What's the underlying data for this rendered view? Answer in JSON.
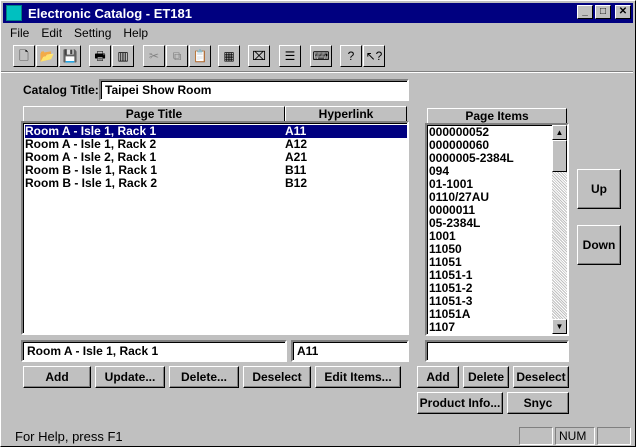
{
  "window": {
    "title": "Electronic Catalog - ET181",
    "minimize_glyph": "_",
    "maximize_glyph": "□",
    "close_glyph": "✕"
  },
  "menu": [
    {
      "label": "File"
    },
    {
      "label": "Edit"
    },
    {
      "label": "Setting"
    },
    {
      "label": "Help"
    }
  ],
  "toolbar": {
    "icons": [
      "new-file-icon",
      "open-folder-icon",
      "save-icon",
      "print-icon",
      "barcode-icon",
      "cut-icon",
      "copy-icon",
      "paste-icon",
      "calculator-icon",
      "scanner-icon",
      "document-icon",
      "keyboard-icon",
      "help-icon",
      "context-help-icon"
    ],
    "glyphs": [
      "🗋",
      "📂",
      "💾",
      "🖶",
      "▥",
      "✂",
      "⧉",
      "📋",
      "▦",
      "⌧",
      "☰",
      "⌨",
      "?",
      "↖?"
    ]
  },
  "catalog": {
    "title_label": "Catalog Title:",
    "title_value": "Taipei Show Room"
  },
  "pages": {
    "columns": [
      "Page Title",
      "Hyperlink"
    ],
    "rows": [
      {
        "title": "Room A - Isle 1, Rack 1",
        "link": "A11",
        "selected": true
      },
      {
        "title": "Room A - Isle 1, Rack 2",
        "link": "A12",
        "selected": false
      },
      {
        "title": "Room A - Isle 2, Rack 1",
        "link": "A21",
        "selected": false
      },
      {
        "title": "Room B - Isle 1, Rack 1",
        "link": "B11",
        "selected": false
      },
      {
        "title": "Room B - Isle 1, Rack 2",
        "link": "B12",
        "selected": false
      }
    ],
    "edit_title": "Room A - Isle 1, Rack 1",
    "edit_link": "A11",
    "buttons": {
      "add": "Add",
      "update": "Update...",
      "delete": "Delete...",
      "deselect": "Deselect",
      "edit_items": "Edit Items..."
    }
  },
  "items": {
    "header": "Page Items",
    "list": [
      "000000052",
      "000000060",
      "0000005-2384L",
      "094",
      "01-1001",
      "0110/27AU",
      "0000011",
      "05-2384L",
      "1001",
      "11050",
      "11051",
      "11051-1",
      "11051-2",
      "11051-3",
      "11051A",
      "1107"
    ],
    "edit_value": "",
    "buttons": {
      "add": "Add",
      "delete": "Delete",
      "deselect": "Deselect",
      "product_info": "Product Info...",
      "sync": "Snyc"
    }
  },
  "side_buttons": {
    "up": "Up",
    "down": "Down"
  },
  "status": {
    "help_text": "For Help, press F1",
    "num": "NUM"
  }
}
